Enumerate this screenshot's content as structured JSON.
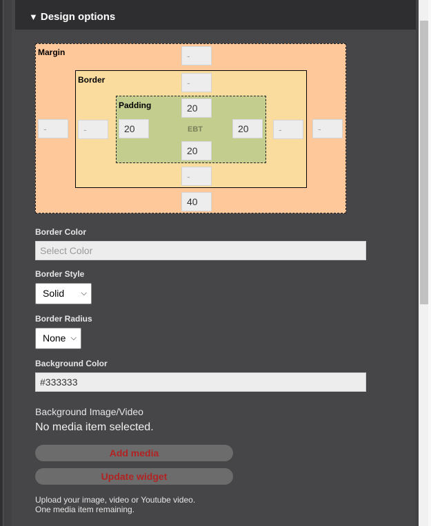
{
  "section": {
    "title": "Design options",
    "toggle_glyph": "▼"
  },
  "box_model": {
    "margin_label": "Margin",
    "border_label": "Border",
    "padding_label": "Padding",
    "center_label": "EBT",
    "margin": {
      "top": "",
      "right": "",
      "bottom": "40",
      "left": ""
    },
    "border": {
      "top": "",
      "right": "",
      "bottom": "",
      "left": ""
    },
    "padding": {
      "top": "20",
      "right": "20",
      "bottom": "20",
      "left": "20"
    },
    "placeholder": "-"
  },
  "border_color": {
    "label": "Border Color",
    "value": "",
    "placeholder": "Select Color"
  },
  "border_style": {
    "label": "Border Style",
    "selected": "Solid"
  },
  "border_radius": {
    "label": "Border Radius",
    "selected": "None"
  },
  "background_color": {
    "label": "Background Color",
    "value": "#333333"
  },
  "media": {
    "label": "Background Image/Video",
    "status": "No media item selected.",
    "add_label": "Add media",
    "update_label": "Update widget",
    "help_line1": "Upload your image, video or Youtube video.",
    "help_line2": "One media item remaining."
  },
  "colors": {
    "margin": "#fec89a",
    "border": "#fbdc9f",
    "padding": "#c3cd8e",
    "button_text": "#b22222"
  }
}
